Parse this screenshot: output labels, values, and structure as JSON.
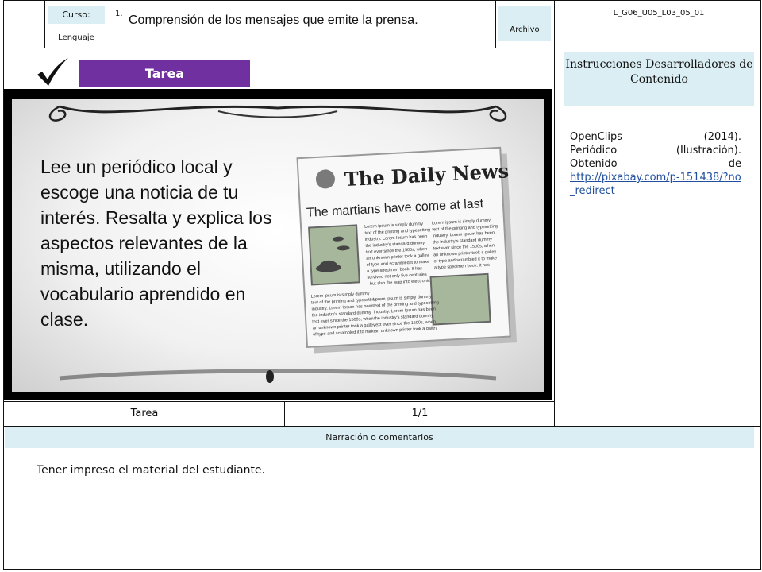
{
  "header": {
    "course_label": "Curso:",
    "course_value": "Lenguaje",
    "item_number": "1.",
    "title": "Comprensión de los mensajes que emite la prensa.",
    "archive_label": "Archivo",
    "code": "L_G06_U05_L03_05_01"
  },
  "main": {
    "task_button": "Tarea",
    "slide_text": "Lee un periódico local y escoge una noticia de tu interés. Resalta y explica los aspectos relevantes de la misma, utilizando el vocabulario aprendido en clase.",
    "newspaper": {
      "masthead": "The Daily News",
      "headline": "The martians have come at last",
      "body_text": "Lorem ipsum is simply dummy text of the printing and typesetting industry. Lorem Ipsum has been the industry's standard dummy text ever since the 1500s, when an unknown printer took a galley of type and scrambled it to make a type specimen book. It has survived not only five centuries , but also the leap into electronic"
    },
    "footer_left": "Tarea",
    "footer_right": "1/1"
  },
  "instructions": {
    "label": "Instrucciones Desarrolladores de Contenido",
    "credit_line1_a": "OpenClips",
    "credit_line1_b": "(2014).",
    "credit_line2_a": "Periódico",
    "credit_line2_b": "(Ilustración).",
    "credit_line3_a": "Obtenido",
    "credit_line3_b": "de",
    "link": "http://pixabay.com/p-151438/?no_redirect"
  },
  "narration": {
    "label": "Narración o comentarios",
    "text": "Tener impreso el material del estudiante."
  },
  "colors": {
    "accent_purple": "#7030a0",
    "panel_blue": "#dbeef3",
    "link_blue": "#1f4e9e"
  }
}
